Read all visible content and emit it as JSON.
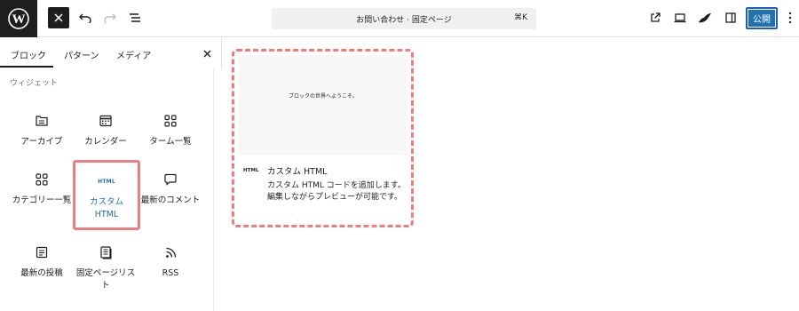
{
  "topbar": {
    "command_title": "お問い合わせ · 固定ページ",
    "command_shortcut": "⌘K",
    "publish_label": "公開"
  },
  "sidebar": {
    "tabs": [
      {
        "label": "ブロック",
        "active": true
      },
      {
        "label": "パターン",
        "active": false
      },
      {
        "label": "メディア",
        "active": false
      }
    ],
    "category": "ウィジェット",
    "items": [
      {
        "label": "アーカイブ",
        "icon": "archive-icon"
      },
      {
        "label": "カレンダー",
        "icon": "calendar-icon"
      },
      {
        "label": "ターム一覧",
        "icon": "term-list-icon"
      },
      {
        "label": "カテゴリー一覧",
        "icon": "categories-icon"
      },
      {
        "label": "カスタム HTML",
        "icon": "html-icon",
        "icon_text": "HTML",
        "selected": true
      },
      {
        "label": "最新のコメント",
        "icon": "comment-icon"
      },
      {
        "label": "最新の投稿",
        "icon": "post-list-icon"
      },
      {
        "label": "固定ページリスト",
        "icon": "page-list-icon"
      },
      {
        "label": "RSS",
        "icon": "rss-icon"
      }
    ]
  },
  "preview": {
    "sample_text": "ブロックの世界へようこそ。",
    "icon_text": "HTML",
    "title": "カスタム HTML",
    "description": "カスタム HTML コードを追加します。編集しながらプレビューが可能です。"
  },
  "colors": {
    "accent": "#2271b1",
    "highlight": "#f07d7d",
    "dark": "#1e1e1e"
  }
}
